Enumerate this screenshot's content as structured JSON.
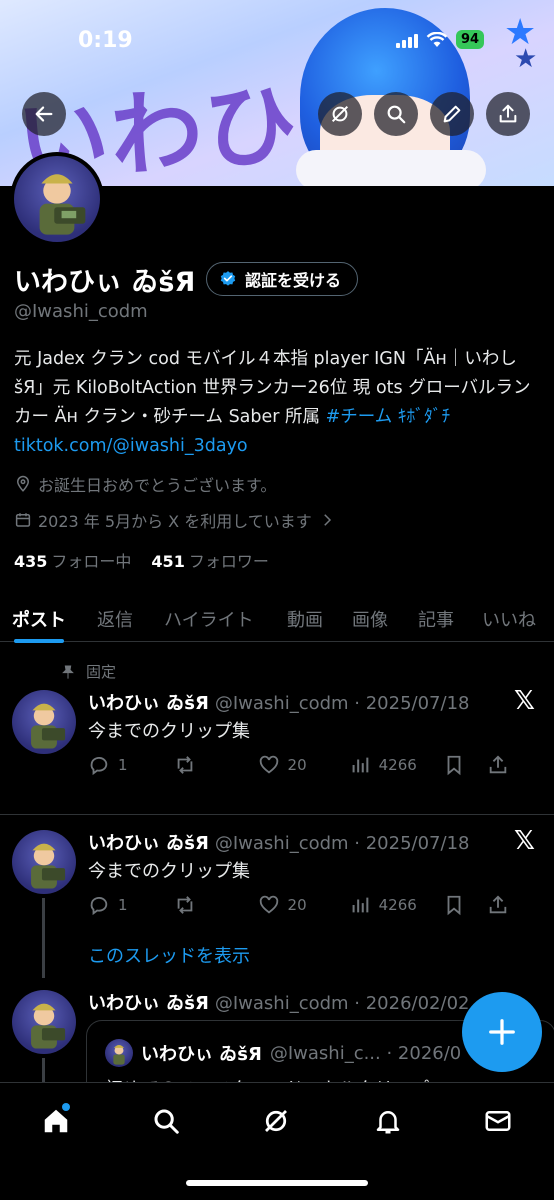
{
  "status_bar": {
    "time": "0:19",
    "battery": "94"
  },
  "banner": {
    "art_text": "いわひぃ"
  },
  "profile": {
    "display_name": "いわひぃ ゐšЯ",
    "verify_label": "認証を受ける",
    "handle": "@Iwashi_codm",
    "bio_text": "元 Jadex クラン cod モバイル４本指 player IGN「Äн｜いわしšЯ」元 KiloBoltAction 世界ランカー26位 現 ots グローバルランカー Äн クラン・砂チーム Saber 所属 ",
    "bio_hashtag": "#チーム ｷﾎﾞﾀﾞﾁ",
    "bio_link": "tiktok.com/@iwashi_3dayo",
    "location": "お誕生日おめでとうございます。",
    "joined": "2023 年 5月から X を利用しています",
    "following_count": "435",
    "following_label": "フォロー中",
    "followers_count": "451",
    "followers_label": "フォロワー"
  },
  "tabs": [
    "ポスト",
    "返信",
    "ハイライト",
    "動画",
    "画像",
    "記事",
    "いいね"
  ],
  "posts": [
    {
      "pinned_label": "固定",
      "name": "いわひぃ ゐšЯ",
      "meta": "@Iwashi_codm · 2025/07/18",
      "text": "今までのクリップ集",
      "replies": "1",
      "likes": "20",
      "views": "4266"
    },
    {
      "name": "いわひぃ ゐšЯ",
      "meta": "@Iwashi_codm · 2025/07/18",
      "text": "今までのクリップ集",
      "replies": "1",
      "likes": "20",
      "views": "4266",
      "show_thread": "このスレッドを表示"
    },
    {
      "name": "いわひぃ ゐšЯ",
      "meta": "@Iwashi_codm · 2026/02/02",
      "quote_name": "いわひぃ ゐšЯ",
      "quote_meta": "@Iwashi_c... · 2026/0",
      "quote_text": "初めてのソロスクワッド・キルクリップ"
    }
  ],
  "colors": {
    "accent": "#1d9bf0",
    "background": "#000000",
    "muted": "#71767b",
    "divider": "#2f3336"
  },
  "icons": [
    "back-arrow-icon",
    "grok-icon",
    "search-icon",
    "edit-icon",
    "share-icon",
    "verified-check-icon",
    "location-icon",
    "calendar-icon",
    "chevron-right-icon",
    "pin-icon",
    "x-logo-icon",
    "reply-icon",
    "repost-icon",
    "like-icon",
    "views-icon",
    "bookmark-icon",
    "plus-icon",
    "home-icon",
    "notifications-icon",
    "messages-icon"
  ]
}
